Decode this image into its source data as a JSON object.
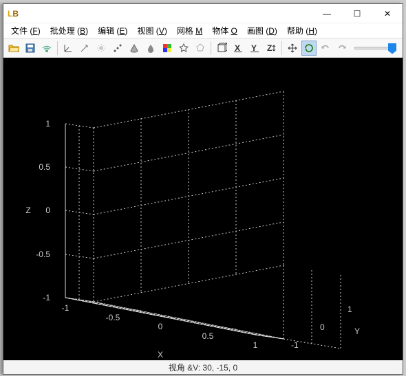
{
  "title": "",
  "win": {
    "min": "—",
    "max": "☐",
    "close": "✕"
  },
  "menu": [
    {
      "label": "文件",
      "key": "F"
    },
    {
      "label": "批处理",
      "key": "B"
    },
    {
      "label": "编辑",
      "key": "E"
    },
    {
      "label": "视图",
      "key": "V"
    },
    {
      "label": "网格",
      "key": "M"
    },
    {
      "label": "物体",
      "key": "O"
    },
    {
      "label": "画图",
      "key": "D"
    },
    {
      "label": "帮助",
      "key": "H"
    }
  ],
  "axes": {
    "x": {
      "label": "X",
      "ticks": [
        "-1",
        "-0.5",
        "0",
        "0.5",
        "1"
      ]
    },
    "y": {
      "label": "Y",
      "ticks": [
        "-1",
        "0",
        "1"
      ]
    },
    "z": {
      "label": "Z",
      "ticks": [
        "-1",
        "-0.5",
        "0",
        "0.5",
        "1"
      ]
    }
  },
  "status": "视角 &V: 30, -15, 0",
  "chart_data": {
    "type": "scatter",
    "title": "",
    "xlabel": "X",
    "ylabel": "Y",
    "zlabel": "Z",
    "xlim": [
      -1,
      1
    ],
    "ylim": [
      -1,
      1
    ],
    "zlim": [
      -1,
      1
    ],
    "xticks": [
      -1,
      -0.5,
      0,
      0.5,
      1
    ],
    "yticks": [
      -1,
      0,
      1
    ],
    "zticks": [
      -1,
      -0.5,
      0,
      0.5,
      1
    ],
    "series": [],
    "view_angle": [
      30,
      -15,
      0
    ]
  }
}
